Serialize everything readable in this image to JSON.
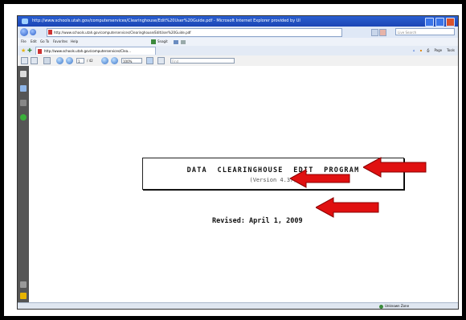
{
  "window": {
    "title": "http://www.schools.utah.gov/computerservices/Clearinghouse/Edit%20User%20Guide.pdf - Microsoft Internet Explorer provided by UI"
  },
  "addressbar": {
    "url": "http://www.schools.utah.gov/computerservices/Clearinghouse/EditUser%20Guide.pdf",
    "search_placeholder": "Live Search"
  },
  "menubar": {
    "items": [
      "File",
      "Edit",
      "Go To",
      "Favorites",
      "Help"
    ],
    "snagit_label": "Snagit"
  },
  "favorites": {
    "tab_label": "http://www.schools.utah.gov/computerservices/Clea...",
    "commands": [
      "Page",
      "Tools"
    ]
  },
  "pdf_toolbar": {
    "page_current": "1",
    "page_total": "/ 42",
    "zoom": "100%",
    "find_placeholder": "Find"
  },
  "document": {
    "title": "DATA  CLEARINGHOUSE  EDIT  PROGRAM",
    "version": "(Version 4.37)",
    "revised": "Revised: April 1, 2009"
  },
  "statusbar": {
    "zone": "Unknown Zone"
  },
  "colors": {
    "titlebar": "#2a5fd1",
    "arrow": "#e01010",
    "sidebar": "#555555"
  }
}
